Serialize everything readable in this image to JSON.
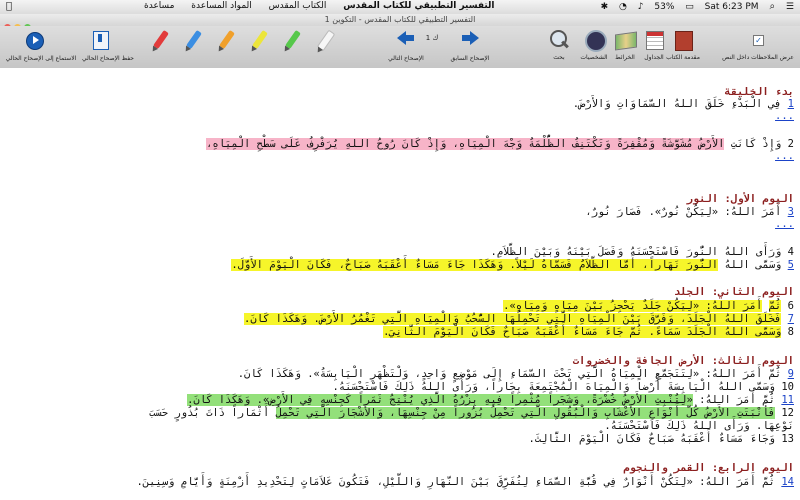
{
  "menubar": {
    "app_name": "التفسير التطبيقي للكتاب المقدس",
    "menus": [
      "الكتاب المقدس",
      "المواد المساعدة",
      "مساعدة"
    ],
    "battery": "53%",
    "clock": "Sat 6:23 PM"
  },
  "window": {
    "title": "التفسير التطبيقي للكتاب المقدس - التكوين 1"
  },
  "toolbar": {
    "show_notes_label": "عرض الملاحظات داخل النص",
    "intro_label": "مقدمة الكتاب",
    "tables_label": "الجداول",
    "maps_label": "الخرائط",
    "people_label": "الشخصيات",
    "search_label": "بحث",
    "prev_label": "الإصحاح السابق",
    "chapter_value": "ك 1",
    "next_label": "الإصحاح التالي",
    "save_label": "حفظ الإصحاح الحالي",
    "listen_label": "الاستماع إلى الإصحاح الحالي",
    "highlighters": [
      "white",
      "green",
      "yellow",
      "orange",
      "blue",
      "red"
    ]
  },
  "content": {
    "more": "...",
    "h_creation": "بدء الخليقة",
    "v1_num": "1",
    "v1": "فِي الْبَدْءِ خَلَقَ اللهُ السَّمَاوَاتِ وَالأَرْضَ.",
    "v2_num": "2",
    "v2_pre": "وَإِذْ كَانَتِ",
    "v2_hl": "الأَرْضُ مُشَوَّشَةً وَمُقْفِرَةً وَتَكْتَنِفُ الظُّلْمَةُ وَجْهَ الْمِيَاهِ، وَإِذْ كَانَ رُوحُ اللهِ يُرَفْرِفُ عَلَى سَطْحِ الْمِيَاهِ،",
    "h_day1": "اليوم الأول: النور",
    "v3_num": "3",
    "v3": "أَمَرَ اللهُ: «لِيَكُنْ نُورٌ». فَصَارَ نُورٌ،",
    "v4_num": "4",
    "v4": "وَرَأَى اللهُ النُّورَ فَاسْتَحْسَنَهُ وَفَصَلَ بَيْنَهُ وَبَيْنَ الظَّلاَمِ.",
    "v5_num": "5",
    "v5_pre": "وَسَمَّى اللهُ",
    "v5_hl": "النُّورَ نَهَاراً، أَمَّا الظَّلاَمُ فَسَمَّاهُ لَيْلاً. وَهَكَذَا جَاءَ مَسَاءٌ أَعْقَبَهُ صَبَاحٌ، فَكَانَ الْيَوْمَ الأَوَّلَ.",
    "h_day2": "اليوم الثاني: الجلد",
    "v6_num": "6",
    "v6_pre": "ثُمَّ",
    "v6_hl": "أَمَرَ اللهُ: «لِيَكُنْ جَلَدٌ يَحْجِزُ بَيْنَ مِيَاهٍ وَمِيَاهٍ».",
    "v7_num": "7",
    "v7_hl": "فَخَلَقَ اللهُ الْجَلَدَ، وَفَرَّقَ بَيْنَ الْمِيَاهِ الَّتِي تَحْمِلُهَا السُّحُبُ وَالْمِيَاهِ الَّتِي تَغْمُرُ الأَرْضَ. وَهَكَذَا كَانَ.",
    "v8_num": "8",
    "v8_hl": "وَسَمَّى اللهُ الْجَلَدَ سَمَاءً. ثُمَّ جَاءَ مَسَاءٌ أَعْقَبَهُ صَبَاحٌ فَكَانَ الْيَوْمَ الثَّانِيَ.",
    "h_day3": "اليوم الثالث: الأرض الجافة والخضروات",
    "v9_num": "9",
    "v9a": "ثُمَّ أَمَرَ اللهُ: «لِتَتَجَمَّعِ الْمِيَاهُ الَّتِي تَحْتَ السَّمَاءِ إِلَى مَوْضِعٍ وَاحِدٍ، وَلْتَظْهَرِ الْيَابِسَةُ». وَهَكَذَا كَانَ.",
    "v10": "وَسَمَّى اللهُ الْيَابِسَةَ أَرْضاً وَالْمِيَاهَ الْمُجْتَمِعَةَ بِحَاراً، وَرَأَى اللهُ ذَلِكَ فَاسْتَحْسَنَهُ.",
    "v11_num": "11",
    "v11_pre": "ثُمَّ أَمَرَ اللهُ:",
    "v11_hl": "«لِتُنْبِتِ الأَرْضُ خُضْرَةً، وَشَجَراً مُثْمِراً فِيهِ بِزْرُهُ الَّذِي يُنْتِجُ ثَمَراً كَجِنْسِهِ فِي الأَرْضِ». وَهَكَذَا كَانَ.",
    "v12_num": "12",
    "v12_hl": "فَأَنْبَتَتِ الأَرْضُ كُلَّ أَنْوَاعِ الأَعْشَابِ وَالْبُقُولِ الَّتِي تَحْمِلُ بُزُوراً مِنْ جِنْسِهَا، وَالأَشْجَارَ الَّتِي تَحْمِلُ",
    "v12_post": "أَثْمَاراً ذَاتَ بُذُورٍ حَسَبَ",
    "v12_cont": "نَوْعِهَا. وَرَأَى اللهُ ذَلِكَ فَاسْتَحْسَنَهُ.",
    "v13_num": "13",
    "v13": "وَجَاءَ مَسَاءٌ أَعْقَبَهُ صَبَاحٌ فَكَانَ الْيَوْمَ الثَّالِثَ.",
    "h_day4": "اليوم الرابع: القمر والنجوم",
    "v14_num": "14",
    "v14": "ثُمَّ أَمَرَ اللهُ: «لِتَكُنْ أَنْوَارٌ فِي قُبَّةِ السَّمَاءِ لِتُفَرِّقَ بَيْنَ النَّهَارِ وَاللَّيْلِ، فَتَكُونَ عَلاَمَاتٍ لِتَحْدِيدِ أَزْمِنَةٍ وَأَيَّامٍ وَسِنِينَ."
  }
}
